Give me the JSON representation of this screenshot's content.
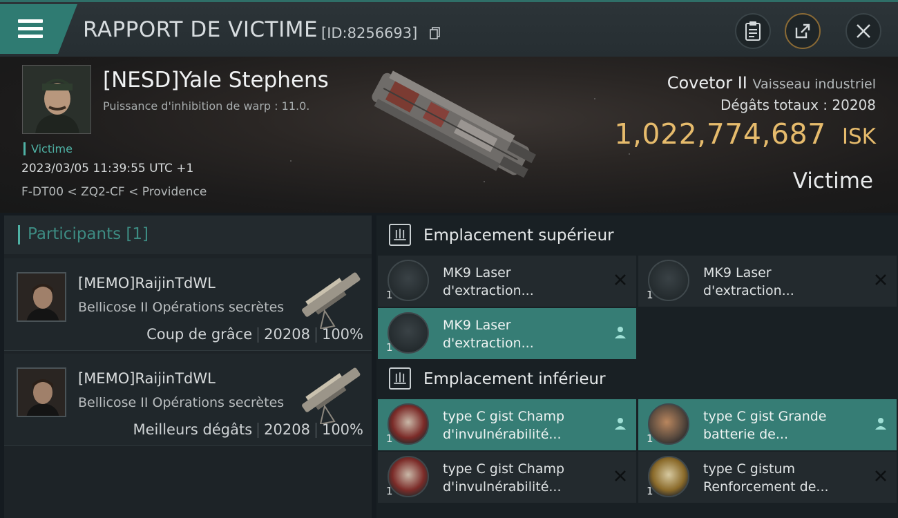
{
  "header": {
    "title": "RAPPORT DE VICTIME",
    "id_text": "[ID:8256693]",
    "icons": [
      "menu-icon",
      "copy-icon",
      "clipboard-icon",
      "share-icon",
      "close-icon"
    ]
  },
  "victim": {
    "name": "[NESD]Yale Stephens",
    "warp_strength": "Puissance d'inhibition de warp : 11.0.",
    "tag": "Victime",
    "date": "2023/03/05 11:39:55 UTC +1",
    "location": "F-DT00 < ZQ2-CF < Providence",
    "ship_name": "Covetor II",
    "ship_class": "Vaisseau industriel",
    "damage_label": "Dégâts totaux :",
    "damage_value": "20208",
    "isk_value": "1,022,774,687",
    "isk_unit": "ISK",
    "role": "Victime"
  },
  "participants": {
    "title": "Participants [1]",
    "rows": [
      {
        "name": "[MEMO]RaijinTdWL",
        "ship": "Bellicose II Opérations secrètes",
        "label": "Coup de grâce",
        "damage": "20208",
        "percent": "100%"
      },
      {
        "name": "[MEMO]RaijinTdWL",
        "ship": "Bellicose II Opérations secrètes",
        "label": "Meilleurs dégâts",
        "damage": "20208",
        "percent": "100%"
      }
    ]
  },
  "fitting": {
    "high_slot_title": "Emplacement supérieur",
    "low_slot_title": "Emplacement inférieur",
    "high_items": [
      {
        "line1": "MK9 Laser",
        "line2": "d'extraction...",
        "qty": "1",
        "status": "destroyed"
      },
      {
        "line1": "MK9 Laser",
        "line2": "d'extraction...",
        "qty": "1",
        "status": "destroyed"
      },
      {
        "line1": "MK9 Laser",
        "line2": "d'extraction...",
        "qty": "1",
        "status": "dropped"
      }
    ],
    "low_items": [
      {
        "line1": "type C gist Champ",
        "line2": "d'invulnérabilité...",
        "qty": "1",
        "status": "dropped"
      },
      {
        "line1": "type C gist Grande",
        "line2": "batterie de...",
        "qty": "1",
        "status": "dropped"
      },
      {
        "line1": "type C gist Champ",
        "line2": "d'invulnérabilité...",
        "qty": "1",
        "status": "destroyed"
      },
      {
        "line1": "type C gistum",
        "line2": "Renforcement de...",
        "qty": "1",
        "status": "destroyed"
      }
    ]
  },
  "colors": {
    "accent_teal": "#367d75",
    "isk_gold": "#e6bb6c",
    "panel_dark": "#1d2327"
  }
}
